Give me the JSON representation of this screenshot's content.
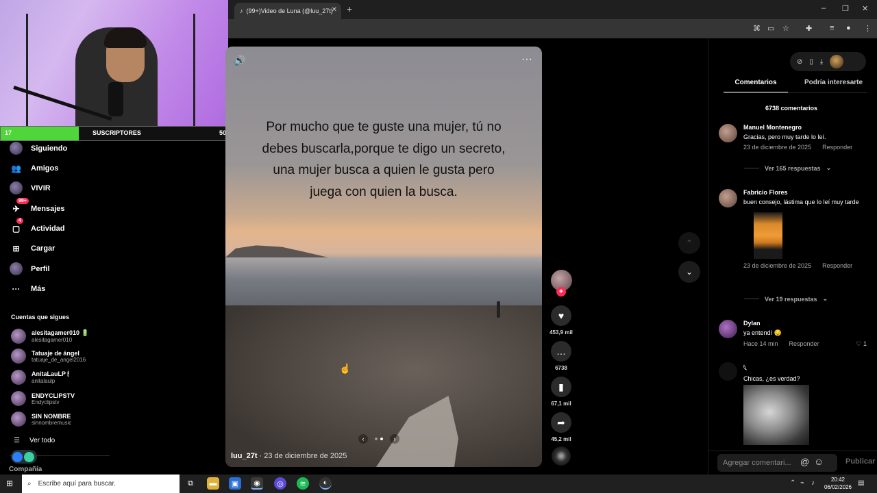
{
  "browser": {
    "tab_title": "(99+)Video de Luna (@luu_27t)",
    "tab_close": "✕",
    "new_tab": "+",
    "window_controls": [
      "–",
      "❐",
      "✕"
    ]
  },
  "stream_overlay": {
    "sub_current": "17",
    "sub_label": "SUSCRIPTORES",
    "sub_goal": "50",
    "progress": 0.34
  },
  "sidebar": {
    "items": [
      {
        "label": "Siguiendo",
        "icon": "following-icon"
      },
      {
        "label": "Amigos",
        "icon": "friends-icon"
      },
      {
        "label": "VIVIR",
        "icon": "live-icon"
      },
      {
        "label": "Mensajes",
        "icon": "messages-icon",
        "badge": "99+"
      },
      {
        "label": "Actividad",
        "icon": "activity-icon",
        "badge": "4"
      },
      {
        "label": "Cargar",
        "icon": "upload-icon"
      },
      {
        "label": "Perfil",
        "icon": "profile-icon"
      },
      {
        "label": "Más",
        "icon": "more-icon"
      }
    ],
    "following_title": "Cuentas que sigues",
    "following": [
      {
        "name": "alesitagamer010 🔋",
        "handle": "alesitagamer010"
      },
      {
        "name": "Tatuaje de ángel",
        "handle": "tatuaje_de_angel2016"
      },
      {
        "name": "AnitaLauLP 🕯",
        "handle": "anitalaulp"
      },
      {
        "name": "ENDYCLIPSTV",
        "handle": "Endyclipstv"
      },
      {
        "name": "SIN NOMBRE",
        "handle": "sinnombremusic"
      }
    ],
    "see_all": "Ver todo",
    "company": "Compañía"
  },
  "video": {
    "caption": "Por mucho que te guste una mujer, tú no debes buscarla,porque te digo un secreto, una mujer busca a quien le gusta pero juega con quien la busca.",
    "author": "luu_27t",
    "date": " · 23 de diciembre de 2025",
    "carousel_prev": "‹",
    "carousel_next": "›"
  },
  "actions": {
    "likes": "453,9 mil",
    "comments": "6738",
    "saves": "67,1 mil",
    "shares": "45,2 mil"
  },
  "comments_panel": {
    "tab_comments": "Comentarios",
    "tab_interesting": "Podría interesarte",
    "count": "6738 comentarios",
    "comments": [
      {
        "name": "Manuel Montenegro",
        "text": "Gracias, pero muy tarde lo leí.",
        "date": "23 de diciembre de 2025",
        "reply": "Responder",
        "replies": "Ver 165 respuestas"
      },
      {
        "name": "Fabricio Flores",
        "text": "buen consejo, lástima que lo leí muy tarde",
        "date": "23 de diciembre de 2025",
        "reply": "Responder",
        "replies": "Ver 19 respuestas"
      },
      {
        "name": "Dylan",
        "text": "ya entendí 😔",
        "date": "Hace 14 min",
        "reply": "Responder",
        "likes": "1"
      },
      {
        "name": "𓆩",
        "text": "Chicas, ¿es verdad?"
      }
    ],
    "input_placeholder": "Agregar comentari...",
    "at": "@",
    "emoji": "☺",
    "publish": "Publicar"
  },
  "taskbar": {
    "search_placeholder": "Escribe aquí para buscar.",
    "time": "20:42",
    "date": "06/02/2026"
  }
}
